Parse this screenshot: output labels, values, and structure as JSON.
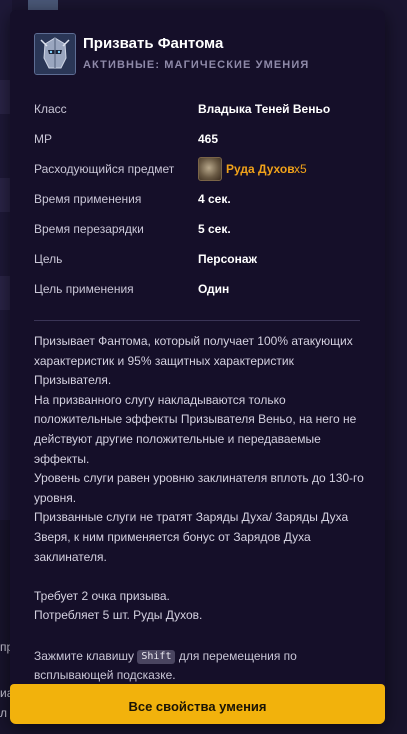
{
  "background": {
    "partial_texts": [
      "пр",
      "иа",
      "л"
    ]
  },
  "tooltip": {
    "title": "Призвать Фантома",
    "subtitle": "АКТИВНЫЕ: МАГИЧЕСКИЕ УМЕНИЯ",
    "icon": "phantom-knight-icon",
    "properties": [
      {
        "label": "Класс",
        "value": "Владыка Теней Веньо"
      },
      {
        "label": "MP",
        "value": "465"
      },
      {
        "label": "Расходующийся предмет",
        "item_name": "Руда Духов",
        "item_qty": "x5",
        "item_icon": "spirit-ore-icon"
      },
      {
        "label": "Время применения",
        "value": "4 сек."
      },
      {
        "label": "Время перезарядки",
        "value": "5 сек."
      },
      {
        "label": "Цель",
        "value": "Персонаж"
      },
      {
        "label": "Цель применения",
        "value": "Один"
      }
    ],
    "description": [
      "Призывает Фантома, который получает 100% атакующих характеристик и 95% защитных характеристик Призывателя.",
      "На призванного слугу накладываются только положительные эффекты Призывателя Веньо, на него не действуют другие положительные и передаваемые эффекты.",
      "Уровень слуги равен уровню заклинателя вплоть до 130-го уровня.",
      "Призванные слуги не тратят Заряды Духа/ Заряды Духа Зверя, к ним применяется бонус от Зарядов Духа заклинателя.",
      "",
      "Требует 2 очка призыва.",
      "Потребляет 5 шт. Руды Духов."
    ],
    "hint": {
      "before": "Зажмите клавишу ",
      "key": "Shift",
      "after": " для перемещения по всплывающей подсказке."
    },
    "all_props_button": "Все свойства умения"
  },
  "colors": {
    "tooltip_bg": "#150f29",
    "accent_button": "#f2b20c",
    "item_text": "#f0a21a",
    "subtitle": "#8e89a8"
  }
}
